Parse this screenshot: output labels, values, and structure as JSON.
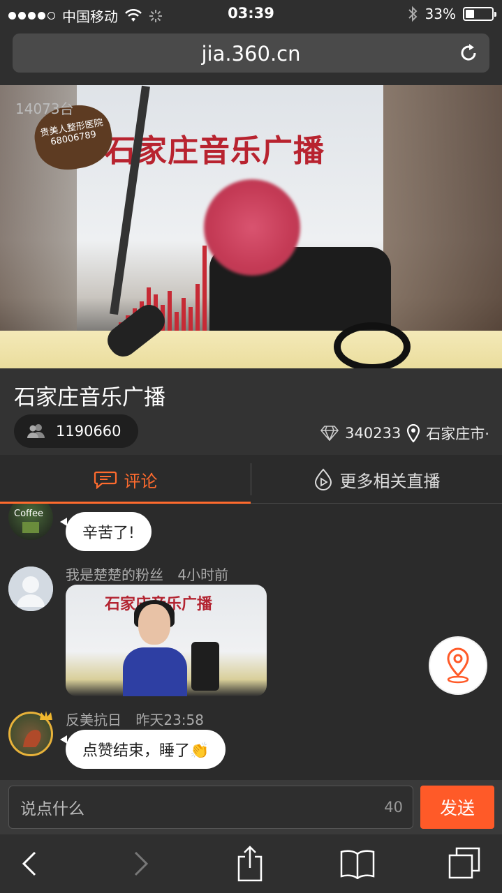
{
  "status_bar": {
    "carrier": "中国移动",
    "time": "03:39",
    "battery_percent": "33%"
  },
  "browser": {
    "url": "jia.360.cn"
  },
  "video": {
    "counter": "14073台",
    "sign_text": "石家庄音乐广播",
    "badge_text": "贵美人整形医院 68006789"
  },
  "stream": {
    "title": "石家庄音乐广播",
    "viewers": "1190660",
    "diamonds": "340233",
    "location": "石家庄市·"
  },
  "tabs": {
    "comments": "评论",
    "more_live": "更多相关直播"
  },
  "comments": [
    {
      "text": "辛苦了!"
    },
    {
      "user": "我是楚楚的粉丝",
      "time": "4小时前",
      "image_sign": "石家庄音乐广播"
    },
    {
      "user": "反美抗日",
      "time": "昨天23:58",
      "text": "点赞结束，睡了👏"
    }
  ],
  "input": {
    "placeholder": "说点什么",
    "char_limit": "40",
    "send_label": "发送"
  },
  "colors": {
    "accent": "#ff6b2e",
    "send": "#ff5a28"
  }
}
